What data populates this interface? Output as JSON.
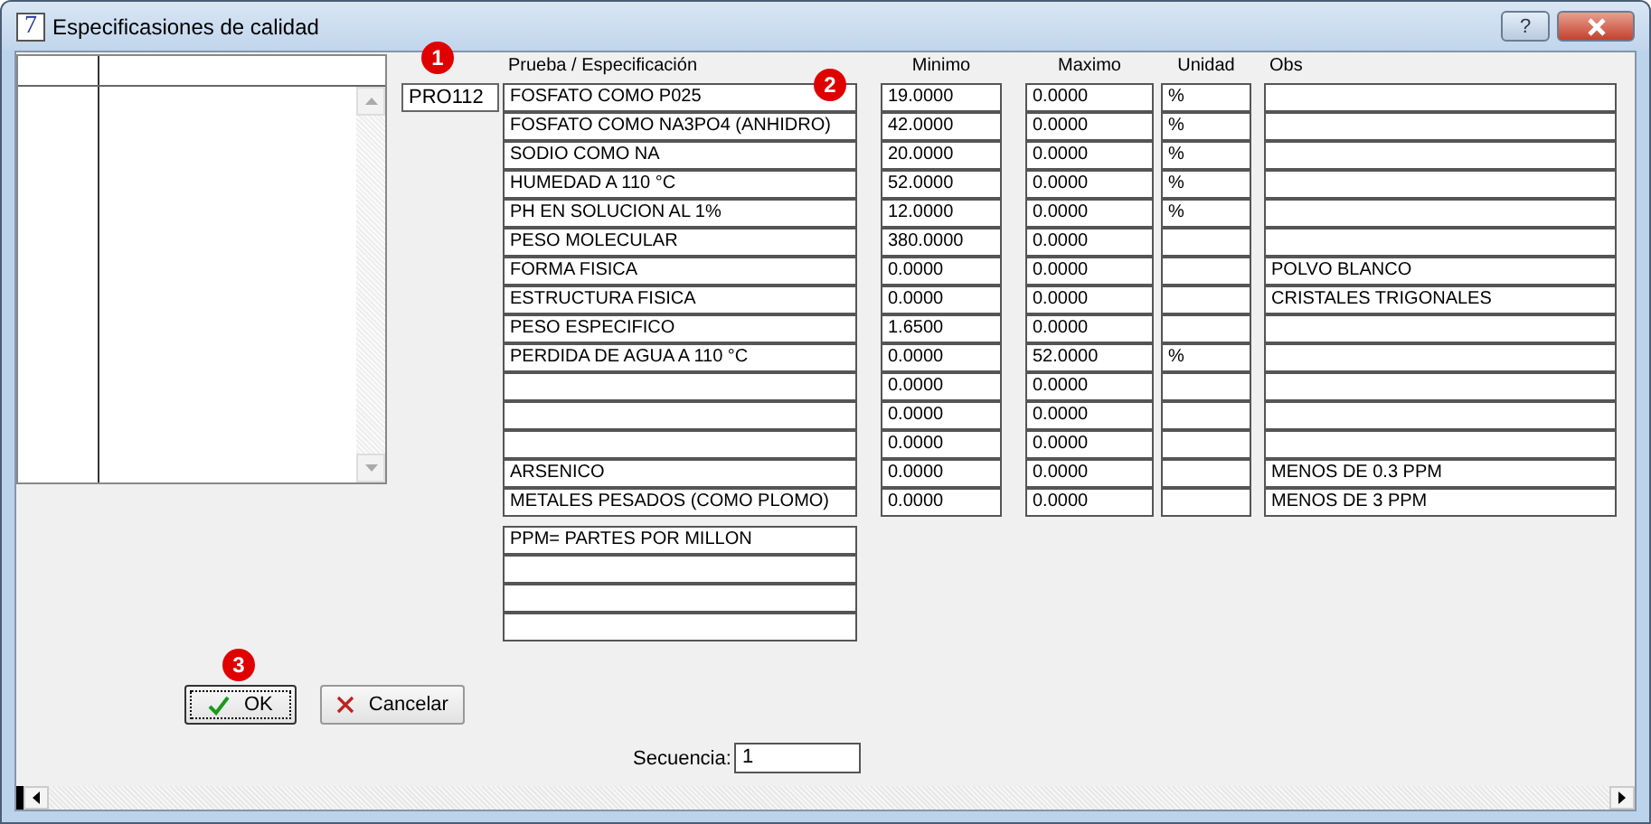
{
  "window": {
    "title": "Especificasiones de calidad",
    "app_icon": "7",
    "help": "?"
  },
  "code": "PRO112",
  "columns": [
    "Prueba / Especificación",
    "Minimo",
    "Maximo",
    "Unidad",
    "Obs"
  ],
  "rows": [
    {
      "spec": "FOSFATO COMO P025",
      "min": "19.0000",
      "max": "0.0000",
      "unit": "%"
    },
    {
      "spec": "FOSFATO COMO NA3PO4 (ANHIDRO)",
      "min": "42.0000",
      "max": "0.0000",
      "unit": "%"
    },
    {
      "spec": "SODIO COMO NA",
      "min": "20.0000",
      "max": "0.0000",
      "unit": "%"
    },
    {
      "spec": "HUMEDAD A 110 °C",
      "min": "52.0000",
      "max": "0.0000",
      "unit": "%"
    },
    {
      "spec": "PH EN SOLUCION AL 1%",
      "min": "12.0000",
      "max": "0.0000",
      "unit": "%"
    },
    {
      "spec": "PESO MOLECULAR",
      "min": "380.0000",
      "max": "0.0000"
    },
    {
      "spec": "FORMA FISICA",
      "min": "0.0000",
      "max": "0.0000",
      "obs": "POLVO BLANCO"
    },
    {
      "spec": "ESTRUCTURA FISICA",
      "min": "0.0000",
      "max": "0.0000",
      "obs": "CRISTALES TRIGONALES"
    },
    {
      "spec": "PESO ESPECIFICO",
      "min": "1.6500",
      "max": "0.0000"
    },
    {
      "spec": "PERDIDA DE AGUA A 110 °C",
      "min": "0.0000",
      "max": "52.0000",
      "unit": "%"
    },
    {
      "min": "0.0000",
      "max": "0.0000"
    },
    {
      "min": "0.0000",
      "max": "0.0000"
    },
    {
      "min": "0.0000",
      "max": "0.0000"
    },
    {
      "spec": "ARSENICO",
      "min": "0.0000",
      "max": "0.0000",
      "obs": "MENOS DE 0.3 PPM"
    },
    {
      "spec": "METALES PESADOS (COMO PLOMO)",
      "min": "0.0000",
      "max": "0.0000",
      "obs": "MENOS DE 3 PPM"
    }
  ],
  "notes": [
    "PPM= PARTES POR MILLON"
  ],
  "buttons": [
    {
      "kind": "ok",
      "label": "OK",
      "focused": true
    },
    {
      "kind": "cancel",
      "label": "Cancelar",
      "focused": false
    }
  ],
  "sequence": {
    "label": "Secuencia:",
    "value": "1"
  },
  "badges": [
    "1",
    "2",
    "3"
  ]
}
